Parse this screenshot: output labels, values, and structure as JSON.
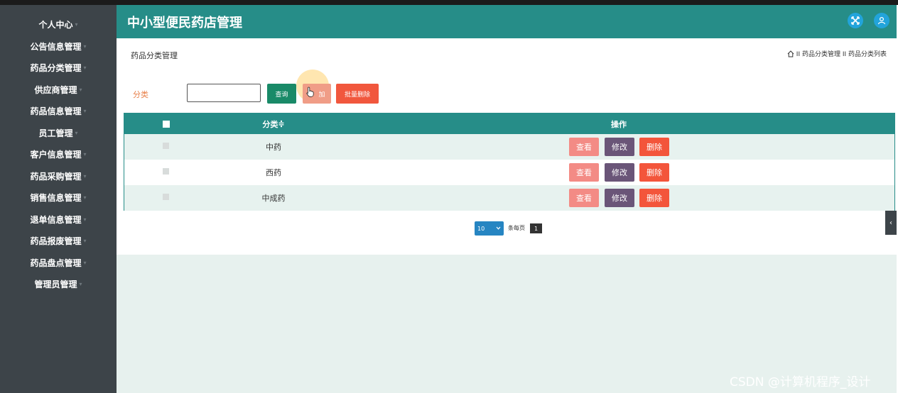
{
  "header": {
    "app_title": "中小型便民药店管理",
    "fullscreen_icon": "fullscreen-icon",
    "user_icon": "user-icon"
  },
  "sidebar": {
    "items": [
      {
        "label": "个人中心"
      },
      {
        "label": "公告信息管理"
      },
      {
        "label": "药品分类管理"
      },
      {
        "label": "供应商管理"
      },
      {
        "label": "药品信息管理"
      },
      {
        "label": "员工管理"
      },
      {
        "label": "客户信息管理"
      },
      {
        "label": "药品采购管理"
      },
      {
        "label": "销售信息管理"
      },
      {
        "label": "退单信息管理"
      },
      {
        "label": "药品报废管理"
      },
      {
        "label": "药品盘点管理"
      },
      {
        "label": "管理员管理"
      }
    ]
  },
  "page": {
    "heading": "药品分类管理",
    "breadcrumb": "II 药品分类管理 II 药品分类列表"
  },
  "filter": {
    "label": "分类",
    "value": "",
    "query_label": "查询",
    "add_label": "加",
    "batch_delete_label": "批量删除"
  },
  "table": {
    "columns": [
      "分类",
      "操作"
    ],
    "sort_indicator": "≑",
    "rows": [
      {
        "category": "中药"
      },
      {
        "category": "西药"
      },
      {
        "category": "中成药"
      }
    ],
    "actions": {
      "view": "查看",
      "edit": "修改",
      "delete": "删除"
    }
  },
  "pagination": {
    "page_size": "10",
    "per_page_label": "条每页",
    "current_page": "1"
  },
  "watermark": "CSDN @计算机程序_设计",
  "colors": {
    "sidebar": "#3d4449",
    "header": "#268d88",
    "query_button": "#198a68",
    "add_button": "#f09d87",
    "batch_delete_button": "#f1573d",
    "view_button": "#f38b85",
    "edit_button": "#6a5578",
    "delete_button": "#f3553b"
  }
}
